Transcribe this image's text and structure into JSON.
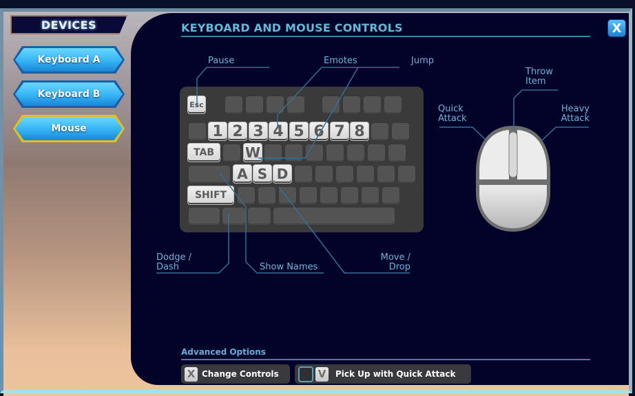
{
  "sidebar": {
    "title": "DEVICES",
    "items": [
      {
        "label": "Keyboard A",
        "selected": false
      },
      {
        "label": "Keyboard B",
        "selected": false
      },
      {
        "label": "Mouse",
        "selected": true
      }
    ]
  },
  "main": {
    "title": "KEYBOARD AND MOUSE CONTROLS",
    "close_label": "X",
    "keyboard": {
      "highlighted_keys": [
        "Esc",
        "1",
        "2",
        "3",
        "4",
        "5",
        "6",
        "7",
        "8",
        "TAB",
        "W",
        "A",
        "S",
        "D",
        "SHIFT"
      ]
    },
    "callouts": {
      "pause": "Pause",
      "emotes": "Emotes",
      "jump": "Jump",
      "dodge_dash_1": "Dodge /",
      "dodge_dash_2": "Dash",
      "show_names": "Show Names",
      "move_drop_1": "Move /",
      "move_drop_2": "Drop",
      "quick_attack_1": "Quick",
      "quick_attack_2": "Attack",
      "throw_item_1": "Throw",
      "throw_item_2": "Item",
      "heavy_attack_1": "Heavy",
      "heavy_attack_2": "Attack"
    },
    "advanced": {
      "title": "Advanced Options",
      "options": [
        {
          "key": "X",
          "label": "Change Controls"
        },
        {
          "key": "V",
          "label": "Pick Up with Quick Attack",
          "checked": false
        }
      ]
    }
  },
  "colors": {
    "panel_bg": "#03032a",
    "accent": "#65b8d6",
    "button_blue": "#35b3f5",
    "selected_border": "#e2c11e"
  }
}
